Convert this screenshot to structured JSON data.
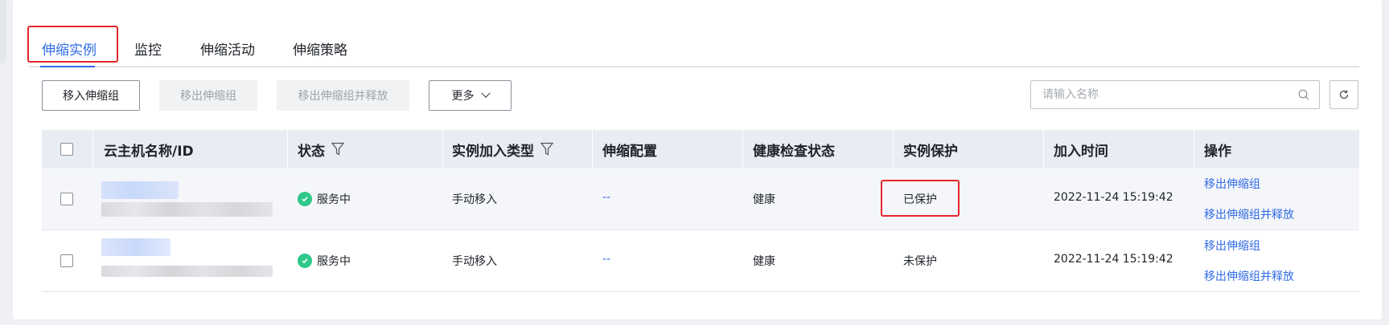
{
  "tabs": [
    {
      "label": "伸缩实例",
      "active": true
    },
    {
      "label": "监控",
      "active": false
    },
    {
      "label": "伸缩活动",
      "active": false
    },
    {
      "label": "伸缩策略",
      "active": false
    }
  ],
  "toolbar": {
    "move_in": "移入伸缩组",
    "move_out": "移出伸缩组",
    "move_out_release": "移出伸缩组并释放",
    "more": "更多"
  },
  "search": {
    "placeholder": "请输入名称",
    "value": ""
  },
  "table": {
    "headers": {
      "name": "云主机名称/ID",
      "status": "状态",
      "join_type": "实例加入类型",
      "config": "伸缩配置",
      "health": "健康检查状态",
      "protection": "实例保护",
      "join_time": "加入时间",
      "actions": "操作"
    },
    "rows": [
      {
        "status": "服务中",
        "join_type": "手动移入",
        "config": "--",
        "health": "健康",
        "protection": "已保护",
        "join_time": "2022-11-24 15:19:42",
        "action_move_out": "移出伸缩组",
        "action_move_out_release": "移出伸缩组并释放"
      },
      {
        "status": "服务中",
        "join_type": "手动移入",
        "config": "--",
        "health": "健康",
        "protection": "未保护",
        "join_time": "2022-11-24 15:19:42",
        "action_move_out": "移出伸缩组",
        "action_move_out_release": "移出伸缩组并释放"
      }
    ]
  },
  "colors": {
    "accent": "#2f6be6",
    "highlight": "#e5262b",
    "status_running": "#2ec88a",
    "header_bg": "#e8ecf3"
  }
}
